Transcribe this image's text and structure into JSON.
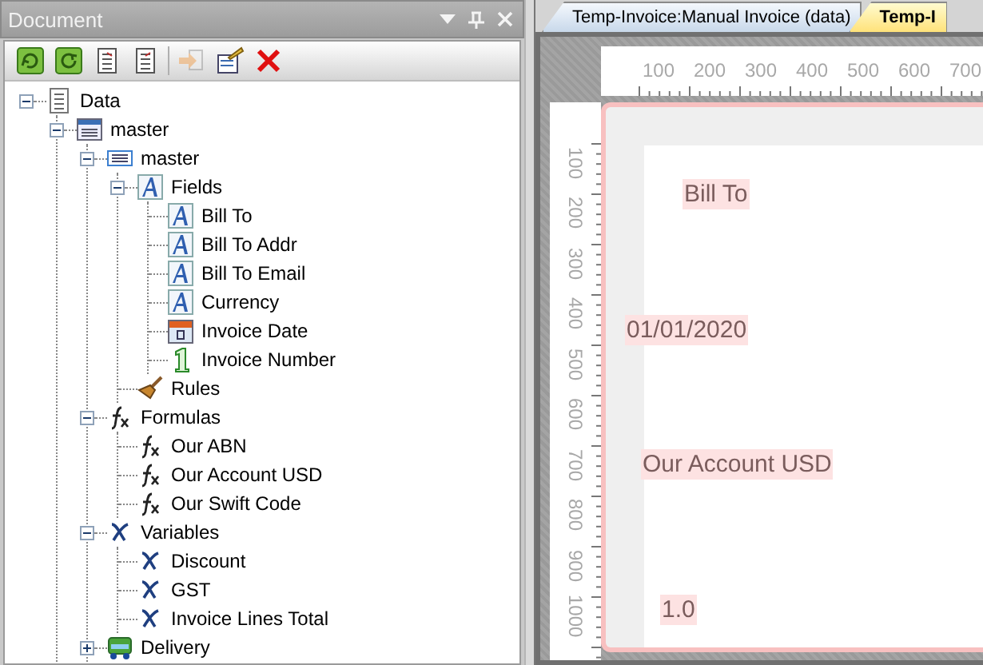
{
  "panel": {
    "title": "Document"
  },
  "toolbar": [
    {
      "kind": "refresh",
      "disabled": false
    },
    {
      "kind": "refresh-up",
      "disabled": false
    },
    {
      "kind": "doc-down",
      "disabled": false
    },
    {
      "kind": "doc-up",
      "disabled": false
    },
    {
      "kind": "export",
      "disabled": true
    },
    {
      "kind": "edit",
      "disabled": false
    },
    {
      "kind": "delete",
      "disabled": false
    }
  ],
  "tree": [
    {
      "label": "Data",
      "kind": "page",
      "expanded": true,
      "children": [
        {
          "label": "master",
          "kind": "table",
          "expanded": true,
          "children": [
            {
              "label": "master",
              "kind": "list",
              "expanded": true,
              "children": [
                {
                  "label": "Fields",
                  "kind": "text",
                  "expanded": true,
                  "children": [
                    {
                      "label": "Bill To",
                      "kind": "text"
                    },
                    {
                      "label": "Bill To Addr",
                      "kind": "text"
                    },
                    {
                      "label": "Bill To Email",
                      "kind": "text"
                    },
                    {
                      "label": "Currency",
                      "kind": "text"
                    },
                    {
                      "label": "Invoice Date",
                      "kind": "date"
                    },
                    {
                      "label": "Invoice Number",
                      "kind": "number"
                    }
                  ]
                },
                {
                  "label": "Rules",
                  "kind": "brush"
                }
              ]
            },
            {
              "label": "Formulas",
              "kind": "formula",
              "expanded": true,
              "children": [
                {
                  "label": "Our ABN",
                  "kind": "formula"
                },
                {
                  "label": "Our Account USD",
                  "kind": "formula"
                },
                {
                  "label": "Our Swift Code",
                  "kind": "formula"
                }
              ]
            },
            {
              "label": "Variables",
              "kind": "variable",
              "expanded": true,
              "children": [
                {
                  "label": "Discount",
                  "kind": "variable"
                },
                {
                  "label": "GST",
                  "kind": "variable"
                },
                {
                  "label": "Invoice Lines Total",
                  "kind": "variable"
                }
              ]
            },
            {
              "label": "Delivery",
              "kind": "van",
              "expanded": false
            }
          ]
        }
      ]
    }
  ],
  "tabs": [
    {
      "label": "Temp-Invoice:Manual Invoice (data)",
      "selected": false
    },
    {
      "label": "Temp-I",
      "selected": true
    }
  ],
  "ruler": {
    "horizontal": [
      "100",
      "200",
      "300",
      "400",
      "500",
      "600",
      "700"
    ],
    "vertical": [
      "100",
      "200",
      "300",
      "400",
      "500",
      "600",
      "700",
      "800",
      "900",
      "1000"
    ]
  },
  "canvas_fields": [
    {
      "text": "Bill To"
    },
    {
      "text": "01/01/2020"
    },
    {
      "text": "Our Account USD"
    },
    {
      "text": "1.0"
    }
  ]
}
